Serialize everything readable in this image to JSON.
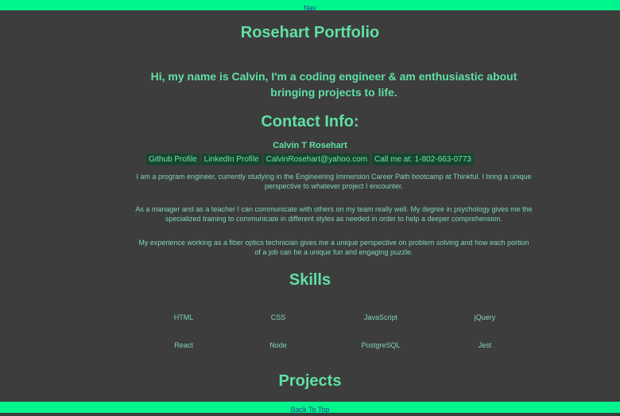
{
  "nav": {
    "label": "Nav"
  },
  "header": {
    "title": "Rosehart Portfolio"
  },
  "intro": "Hi, my name is Calvin, I'm a coding engineer & am enthusiastic about bringing projects to life.",
  "contact": {
    "heading": "Contact Info:",
    "name": "Calvin T Rosehart",
    "links": [
      "Github Profile",
      "LinkedIn Profile",
      "CalvinRosehart@yahoo.com",
      "Call me at: 1-802-663-0773"
    ]
  },
  "bio": [
    "I am a program engineer, currently studying in the Engineering Immersion Career Path bootcamp at Thinkful. I bring a unique perspective to whatever project I encounter.",
    "As a manager and as a teacher I can communicate with others on my team really well. My degree in psychology gives me the specialized training to communicate in different styles as needed in order to help a deeper comprehension.",
    "My experience working as a fiber optics technician gives me a unique perspective on problem solving and how each portion of a job can be a unique fun and engaging puzzle."
  ],
  "skills": {
    "heading": "Skills",
    "items": [
      "HTML",
      "CSS",
      "JavaScript",
      "jQuery",
      "React",
      "Node",
      "PostgreSQL",
      "Jest"
    ]
  },
  "projects": {
    "heading": "Projects"
  },
  "footer": {
    "back_to_top": "Back To Top"
  }
}
